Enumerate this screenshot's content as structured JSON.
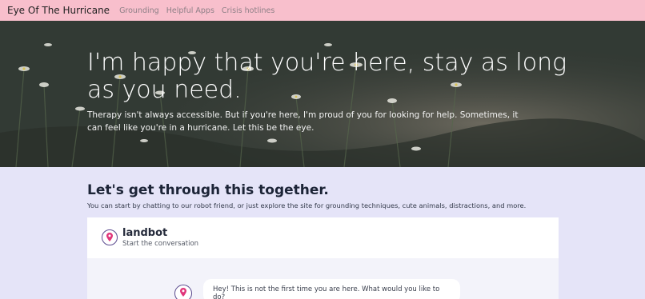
{
  "navbar": {
    "brand": "Eye Of The Hurricane",
    "links": [
      "Grounding",
      "Helpful Apps",
      "Crisis hotlines"
    ]
  },
  "hero": {
    "title": "I'm happy that you're here, stay as long as you need.",
    "subtitle": "Therapy isn't always accessible. But if you're here, I'm proud of you for looking for help. Sometimes, it can feel like you're in a hurricane. Let this be the eye."
  },
  "intro": {
    "title": "Let's get through this together.",
    "text": "You can start by chatting to our robot friend, or just explore the site for grounding techniques, cute animals, distractions, and more."
  },
  "chatbot": {
    "name": "landbot",
    "tagline": "Start the conversation",
    "logo_icon": "map-pin-icon",
    "messages": [
      "Hey! This is not the first time you are here. What would you like to do?"
    ]
  },
  "colors": {
    "navbar_bg": "#f8bfcc",
    "page_bg": "#e5e4f8",
    "accent": "#5a4a8e",
    "pin": "#e0357a"
  }
}
